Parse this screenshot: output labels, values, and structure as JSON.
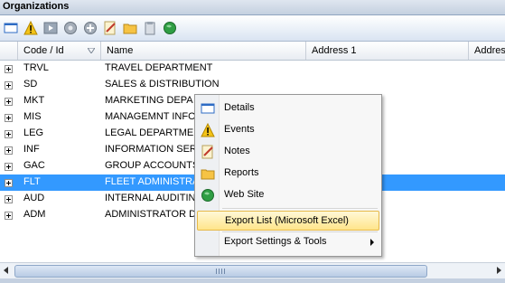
{
  "window": {
    "title": "Organizations"
  },
  "toolbar": {
    "buttons": [
      "details-icon",
      "warning-icon",
      "media-icon",
      "circle-icon",
      "add-icon",
      "notes-icon",
      "folder-icon",
      "clipboard-icon",
      "globe-icon"
    ]
  },
  "grid": {
    "columns": [
      "Code / Id",
      "Name",
      "Address 1",
      "Addres"
    ],
    "rows": [
      {
        "code": "TRVL",
        "name": "TRAVEL DEPARTMENT"
      },
      {
        "code": "SD",
        "name": "SALES & DISTRIBUTION"
      },
      {
        "code": "MKT",
        "name": "MARKETING DEPA"
      },
      {
        "code": "MIS",
        "name": "MANAGEMNT INFO"
      },
      {
        "code": "LEG",
        "name": "LEGAL DEPARTMEN"
      },
      {
        "code": "INF",
        "name": "INFORMATION SER"
      },
      {
        "code": "GAC",
        "name": "GROUP ACCOUNTS"
      },
      {
        "code": "FLT",
        "name": "FLEET ADMINISTRA"
      },
      {
        "code": "AUD",
        "name": "INTERNAL AUDITIN"
      },
      {
        "code": "ADM",
        "name": "ADMINISTRATOR D"
      }
    ],
    "selected_row": "FLT"
  },
  "context_menu": {
    "items": [
      {
        "label": "Details",
        "icon": "details-icon"
      },
      {
        "label": "Events",
        "icon": "warning-icon"
      },
      {
        "label": "Notes",
        "icon": "notes-icon"
      },
      {
        "label": "Reports",
        "icon": "folder-icon"
      },
      {
        "label": "Web Site",
        "icon": "globe-icon"
      },
      {
        "label": "Export List (Microsoft Excel)",
        "icon": ""
      },
      {
        "label": "Export Settings & Tools",
        "icon": ""
      }
    ],
    "highlighted": "Export List (Microsoft Excel)"
  },
  "colors": {
    "selection": "#3399ff",
    "menu_highlight": "#ffe58a"
  }
}
